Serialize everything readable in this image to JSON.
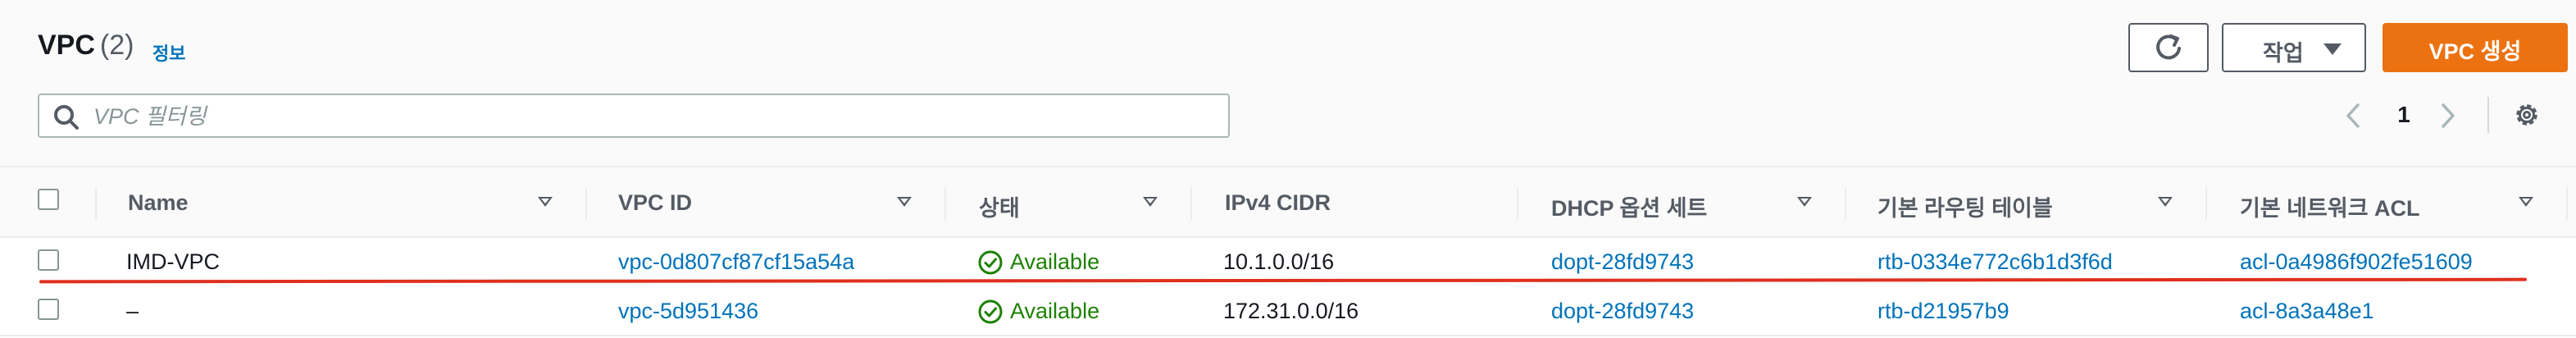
{
  "header": {
    "title": "VPC",
    "count": "(2)",
    "info_link": "정보",
    "refresh_icon": "refresh-icon",
    "actions_label": "작업",
    "create_label": "VPC 생성",
    "colors": {
      "primary": "#ec7211",
      "link": "#0073bb",
      "success": "#1d8102",
      "highlight": "#e0301e"
    }
  },
  "search": {
    "placeholder": "VPC 필터링",
    "value": ""
  },
  "pagination": {
    "current_page": "1"
  },
  "table": {
    "columns": [
      "Name",
      "VPC ID",
      "상태",
      "IPv4 CIDR",
      "DHCP 옵션 세트",
      "기본 라우팅 테이블",
      "기본 네트워크 ACL"
    ],
    "rows": [
      {
        "selected": false,
        "name": "IMD-VPC",
        "vpc_id": "vpc-0d807cf87cf15a54a",
        "status": "Available",
        "cidr": "10.1.0.0/16",
        "dhcp": "dopt-28fd9743",
        "route_table": "rtb-0334e772c6b1d3f6d",
        "acl": "acl-0a4986f902fe51609"
      },
      {
        "selected": false,
        "name": "–",
        "vpc_id": "vpc-5d951436",
        "status": "Available",
        "cidr": "172.31.0.0/16",
        "dhcp": "dopt-28fd9743",
        "route_table": "rtb-d21957b9",
        "acl": "acl-8a3a48e1"
      }
    ]
  }
}
